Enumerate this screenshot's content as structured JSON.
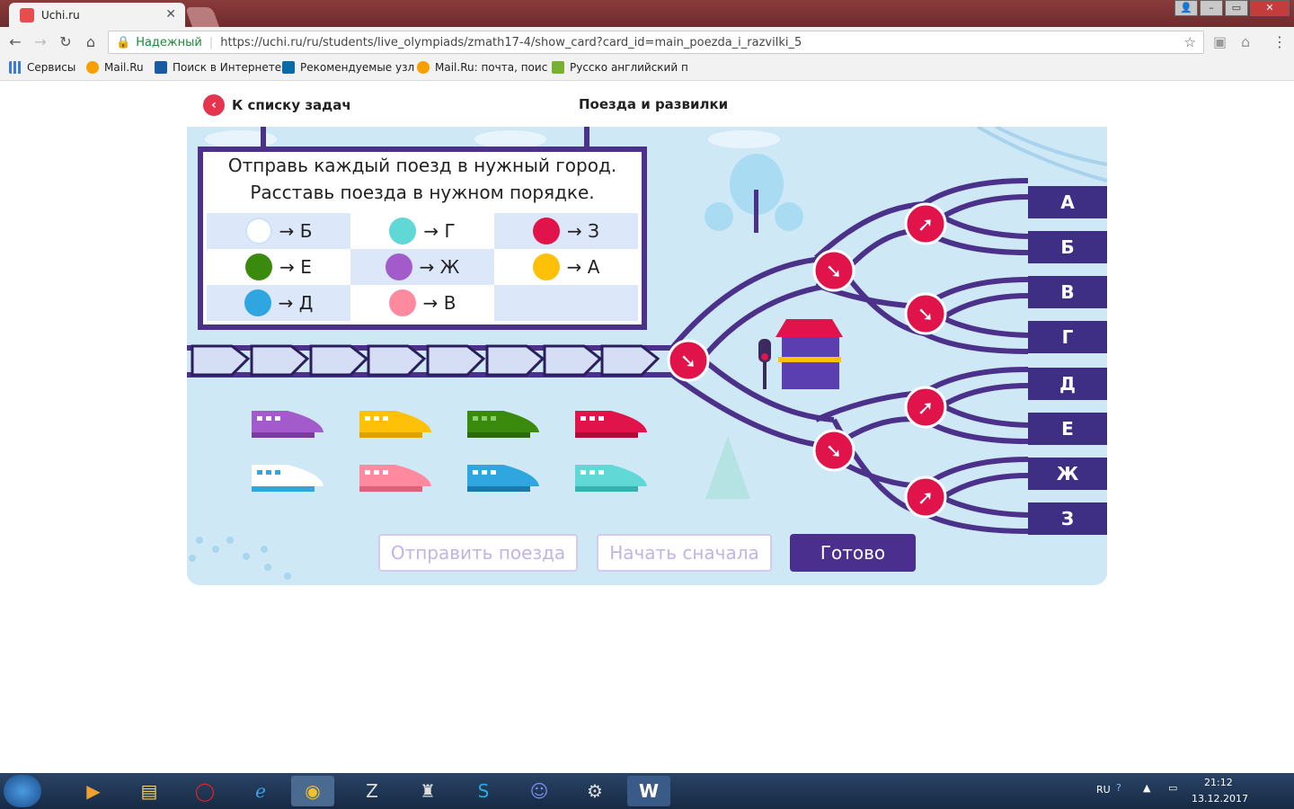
{
  "browser": {
    "tab_title": "Uchi.ru",
    "tab_close": "✕",
    "secure_label": "Надежный",
    "url": "https://uchi.ru/ru/students/live_olympiads/zmath17-4/show_card?card_id=main_poezda_i_razvilki_5",
    "bookmarks": [
      "Сервисы",
      "Mail.Ru",
      "Поиск в Интернете",
      "Рекомендуемые узл",
      "Mail.Ru: почта, поис",
      "Русско английский п"
    ]
  },
  "page": {
    "back_label": "К списку задач",
    "title": "Поезда и развилки"
  },
  "task": {
    "line1": "Отправь каждый поезд в нужный город.",
    "line2": "Расставь поезда в нужном порядке.",
    "legend": [
      {
        "color": "#ffffff",
        "city": "Б"
      },
      {
        "color": "#5fd8d6",
        "city": "Г"
      },
      {
        "color": "#e0144a",
        "city": "З"
      },
      {
        "color": "#3a8a0e",
        "city": "Е"
      },
      {
        "color": "#a35bcc",
        "city": "Ж"
      },
      {
        "color": "#ffc107",
        "city": "А"
      },
      {
        "color": "#2fa6e0",
        "city": "Д"
      },
      {
        "color": "#ff8aa0",
        "city": "В"
      }
    ],
    "arrow": "→"
  },
  "cities": [
    "А",
    "Б",
    "В",
    "Г",
    "Д",
    "Е",
    "Ж",
    "З"
  ],
  "trains": {
    "row1": [
      "#a35bcc",
      "#ffc107",
      "#3a8a0e",
      "#e0144a"
    ],
    "row2": [
      "#ffffff",
      "#ff8aa0",
      "#2fa6e0",
      "#5fd8d6"
    ]
  },
  "buttons": {
    "send": "Отправить поезда",
    "restart": "Начать сначала",
    "done": "Готово"
  },
  "tray": {
    "lang": "RU",
    "time": "21:12",
    "date": "13.12.2017"
  }
}
